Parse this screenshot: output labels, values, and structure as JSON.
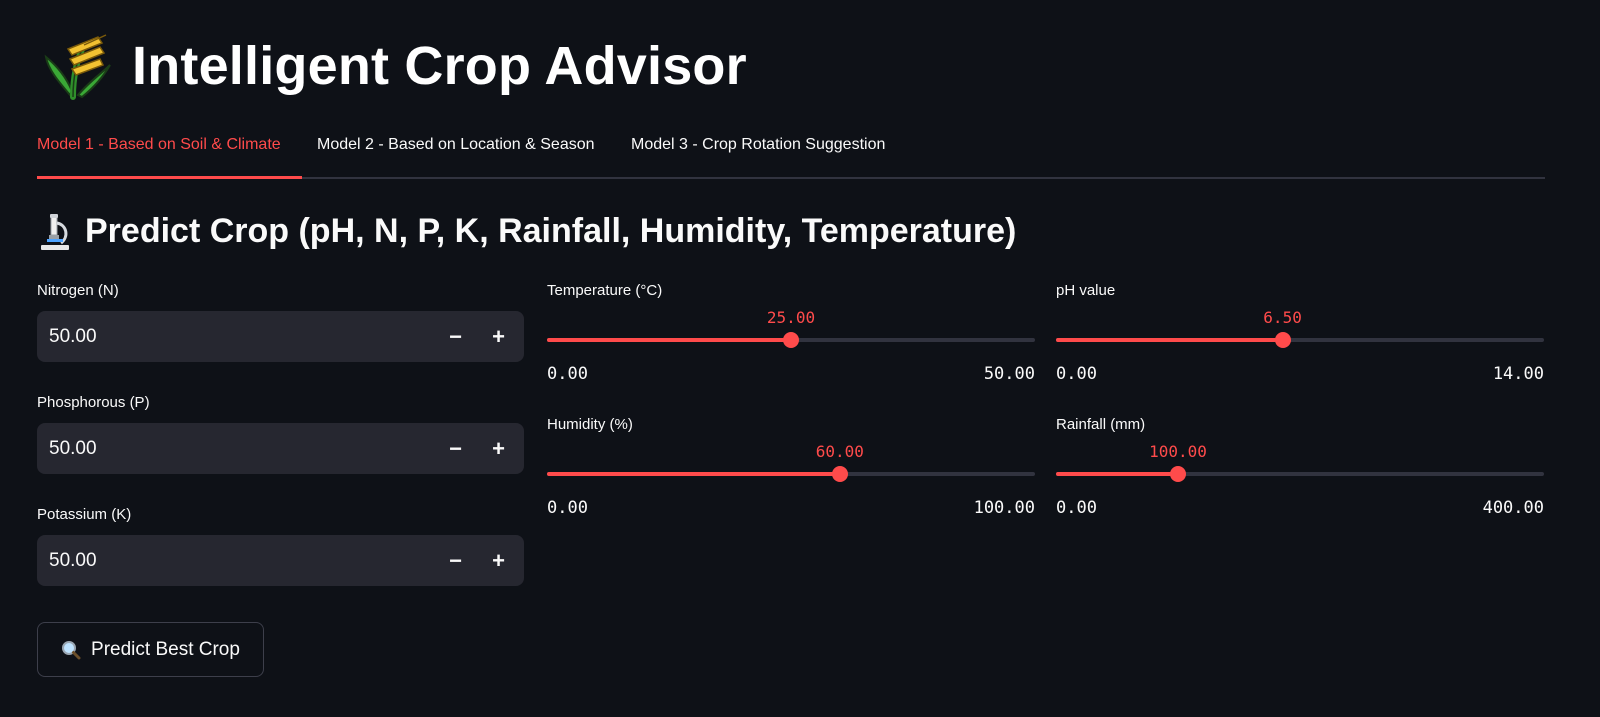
{
  "app": {
    "title": "Intelligent Crop Advisor",
    "logo_icon": "crop-plant-icon"
  },
  "tabs": [
    {
      "label": "Model 1 - Based on Soil & Climate",
      "active": true
    },
    {
      "label": "Model 2 - Based on Location & Season",
      "active": false
    },
    {
      "label": "Model 3 - Crop Rotation Suggestion",
      "active": false
    }
  ],
  "section": {
    "icon": "microscope-icon",
    "title": "Predict Crop (pH, N, P, K, Rainfall, Humidity, Temperature)"
  },
  "inputs": {
    "nitrogen": {
      "label": "Nitrogen (N)",
      "value": "50.00",
      "minus": "−",
      "plus": "+"
    },
    "phosphorous": {
      "label": "Phosphorous (P)",
      "value": "50.00",
      "minus": "−",
      "plus": "+"
    },
    "potassium": {
      "label": "Potassium (K)",
      "value": "50.00",
      "minus": "−",
      "plus": "+"
    }
  },
  "sliders": {
    "temperature": {
      "label": "Temperature (°C)",
      "value": 25.0,
      "value_text": "25.00",
      "min": 0.0,
      "max": 50.0,
      "min_text": "0.00",
      "max_text": "50.00"
    },
    "humidity": {
      "label": "Humidity (%)",
      "value": 60.0,
      "value_text": "60.00",
      "min": 0.0,
      "max": 100.0,
      "min_text": "0.00",
      "max_text": "100.00"
    },
    "ph": {
      "label": "pH value",
      "value": 6.5,
      "value_text": "6.50",
      "min": 0.0,
      "max": 14.0,
      "min_text": "0.00",
      "max_text": "14.00"
    },
    "rainfall": {
      "label": "Rainfall (mm)",
      "value": 100.0,
      "value_text": "100.00",
      "min": 0.0,
      "max": 400.0,
      "min_text": "0.00",
      "max_text": "400.00"
    }
  },
  "predict_button": {
    "label": "Predict Best Crop",
    "icon": "magnifier-icon"
  },
  "colors": {
    "background": "#0e1117",
    "accent": "#ff4b4b",
    "input_bg": "#262730",
    "track": "#31333f"
  }
}
